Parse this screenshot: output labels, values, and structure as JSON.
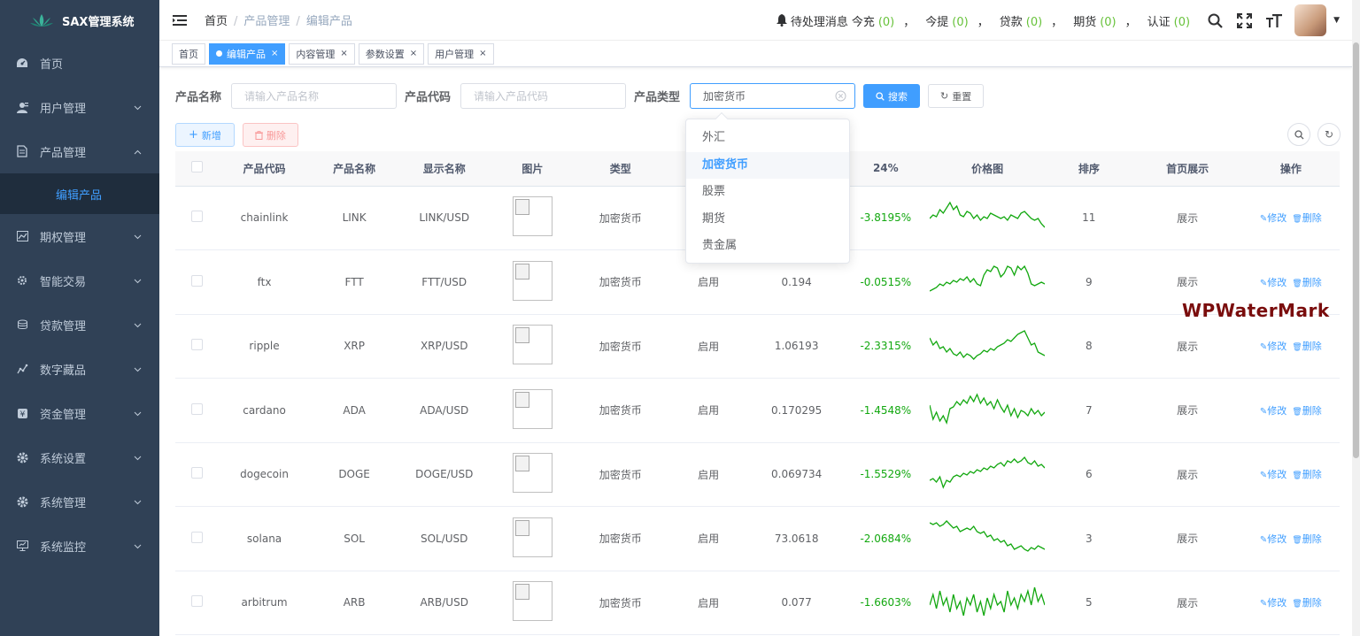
{
  "app": {
    "title": "SAX管理系统"
  },
  "sidebar": {
    "items": [
      {
        "label": "首页",
        "icon": "dashboard-icon"
      },
      {
        "label": "用户管理",
        "icon": "user-icon"
      },
      {
        "label": "产品管理",
        "icon": "document-icon",
        "expanded": true
      },
      {
        "label": "期权管理",
        "icon": "chart-icon"
      },
      {
        "label": "智能交易",
        "icon": "gear-small-icon"
      },
      {
        "label": "贷款管理",
        "icon": "coins-icon"
      },
      {
        "label": "数字藏品",
        "icon": "graph-icon"
      },
      {
        "label": "资金管理",
        "icon": "money-icon"
      },
      {
        "label": "系统设置",
        "icon": "settings-icon"
      },
      {
        "label": "系统管理",
        "icon": "settings-icon"
      },
      {
        "label": "系统监控",
        "icon": "monitor-icon"
      }
    ],
    "sub_active": "编辑产品"
  },
  "navbar": {
    "breadcrumb": [
      "首页",
      "产品管理",
      "编辑产品"
    ],
    "pending_label": "待处理消息",
    "counters": [
      {
        "label": "今充",
        "count": "(0)"
      },
      {
        "label": "今提",
        "count": "(0)"
      },
      {
        "label": "贷款",
        "count": "(0)"
      },
      {
        "label": "期货",
        "count": "(0)"
      },
      {
        "label": "认证",
        "count": "(0)"
      }
    ],
    "sep": "，"
  },
  "tags": [
    {
      "label": "首页",
      "closable": false,
      "active": false
    },
    {
      "label": "编辑产品",
      "closable": true,
      "active": true
    },
    {
      "label": "内容管理",
      "closable": true,
      "active": false
    },
    {
      "label": "参数设置",
      "closable": true,
      "active": false
    },
    {
      "label": "用户管理",
      "closable": true,
      "active": false
    }
  ],
  "search": {
    "name_label": "产品名称",
    "name_placeholder": "请输入产品名称",
    "code_label": "产品代码",
    "code_placeholder": "请输入产品代码",
    "type_label": "产品类型",
    "type_value": "加密货币",
    "search_button": "搜索",
    "reset_button": "重置"
  },
  "toolbar": {
    "add": "新增",
    "delete": "删除"
  },
  "dropdown": {
    "options": [
      "外汇",
      "加密货币",
      "股票",
      "期货",
      "贵金属"
    ],
    "selected": "加密货币"
  },
  "table": {
    "headers": [
      "产品代码",
      "产品名称",
      "显示名称",
      "图片",
      "类型",
      "",
      "",
      "24%",
      "价格图",
      "排序",
      "首页展示",
      "操作"
    ],
    "edit_label": "修改",
    "delete_label": "删除",
    "rows": [
      {
        "code": "chainlink",
        "name": "LINK",
        "display": "LINK/USD",
        "type": "加密货币",
        "status": "",
        "price": "",
        "change": "-3.8195%",
        "sort": "11",
        "home": "展示",
        "spark": [
          0.55,
          0.45,
          0.5,
          0.3,
          0.4,
          0.25,
          0.1,
          0.3,
          0.2,
          0.45,
          0.5,
          0.35,
          0.4,
          0.55,
          0.45,
          0.6,
          0.5,
          0.55,
          0.4,
          0.45,
          0.5,
          0.55,
          0.5,
          0.6,
          0.45,
          0.5,
          0.55,
          0.4,
          0.35,
          0.45,
          0.55,
          0.6,
          0.55,
          0.7,
          0.8
        ]
      },
      {
        "code": "ftx",
        "name": "FTT",
        "display": "FTT/USD",
        "type": "加密货币",
        "status": "启用",
        "price": "0.194",
        "change": "-0.0515%",
        "sort": "9",
        "home": "展示",
        "spark": [
          0.8,
          0.75,
          0.7,
          0.6,
          0.65,
          0.55,
          0.6,
          0.5,
          0.55,
          0.45,
          0.5,
          0.4,
          0.55,
          0.45,
          0.6,
          0.65,
          0.35,
          0.2,
          0.25,
          0.1,
          0.15,
          0.4,
          0.3,
          0.1,
          0.15,
          0.35,
          0.1,
          0.2,
          0.1,
          0.3,
          0.6,
          0.65,
          0.6,
          0.55,
          0.6
        ]
      },
      {
        "code": "ripple",
        "name": "XRP",
        "display": "XRP/USD",
        "type": "加密货币",
        "status": "启用",
        "price": "1.06193",
        "change": "-2.3315%",
        "sort": "8",
        "home": "展示",
        "spark": [
          0.3,
          0.5,
          0.4,
          0.6,
          0.55,
          0.7,
          0.6,
          0.75,
          0.8,
          0.7,
          0.85,
          0.75,
          0.8,
          0.9,
          0.8,
          0.75,
          0.65,
          0.7,
          0.6,
          0.65,
          0.55,
          0.5,
          0.45,
          0.35,
          0.4,
          0.3,
          0.2,
          0.15,
          0.1,
          0.3,
          0.5,
          0.45,
          0.7,
          0.75,
          0.8
        ]
      },
      {
        "code": "cardano",
        "name": "ADA",
        "display": "ADA/USD",
        "type": "加密货币",
        "status": "启用",
        "price": "0.170295",
        "change": "-1.4548%",
        "sort": "7",
        "home": "展示",
        "spark": [
          0.4,
          0.8,
          0.6,
          0.85,
          0.7,
          0.9,
          0.5,
          0.45,
          0.3,
          0.4,
          0.25,
          0.35,
          0.15,
          0.3,
          0.1,
          0.35,
          0.2,
          0.4,
          0.3,
          0.5,
          0.25,
          0.45,
          0.6,
          0.4,
          0.7,
          0.5,
          0.75,
          0.55,
          0.6,
          0.7,
          0.5,
          0.65,
          0.55,
          0.7,
          0.6
        ]
      },
      {
        "code": "dogecoin",
        "name": "DOGE",
        "display": "DOGE/USD",
        "type": "加密货币",
        "status": "启用",
        "price": "0.069734",
        "change": "-1.5529%",
        "sort": "6",
        "home": "展示",
        "spark": [
          0.7,
          0.65,
          0.75,
          0.6,
          0.9,
          0.7,
          0.75,
          0.6,
          0.55,
          0.6,
          0.5,
          0.55,
          0.45,
          0.5,
          0.4,
          0.45,
          0.35,
          0.4,
          0.3,
          0.35,
          0.25,
          0.2,
          0.3,
          0.15,
          0.2,
          0.1,
          0.2,
          0.15,
          0.05,
          0.2,
          0.25,
          0.15,
          0.3,
          0.25,
          0.35
        ]
      },
      {
        "code": "solana",
        "name": "SOL",
        "display": "SOL/USD",
        "type": "加密货币",
        "status": "启用",
        "price": "73.0618",
        "change": "-2.0684%",
        "sort": "3",
        "home": "展示",
        "spark": [
          0.1,
          0.15,
          0.1,
          0.2,
          0.15,
          0.05,
          0.15,
          0.25,
          0.2,
          0.35,
          0.3,
          0.25,
          0.3,
          0.2,
          0.35,
          0.4,
          0.35,
          0.5,
          0.45,
          0.6,
          0.55,
          0.65,
          0.6,
          0.75,
          0.7,
          0.85,
          0.8,
          0.75,
          0.85,
          0.9,
          0.8,
          0.85,
          0.75,
          0.8,
          0.85
        ]
      },
      {
        "code": "arbitrum",
        "name": "ARB",
        "display": "ARB/USD",
        "type": "加密货币",
        "status": "启用",
        "price": "0.077",
        "change": "-1.6603%",
        "sort": "5",
        "home": "展示",
        "spark": [
          0.6,
          0.3,
          0.7,
          0.2,
          0.6,
          0.4,
          0.8,
          0.3,
          0.7,
          0.5,
          0.9,
          0.4,
          0.6,
          0.3,
          0.8,
          0.5,
          0.9,
          0.4,
          0.7,
          0.3,
          0.6,
          0.5,
          0.8,
          0.2,
          0.6,
          0.4,
          0.7,
          0.3,
          0.5,
          0.2,
          0.6,
          0.1,
          0.5,
          0.3,
          0.6
        ]
      }
    ]
  },
  "watermark": "WPWaterMark",
  "colors": {
    "sidebar_bg": "#304156",
    "primary": "#409eff",
    "positive_green": "#13a810"
  }
}
